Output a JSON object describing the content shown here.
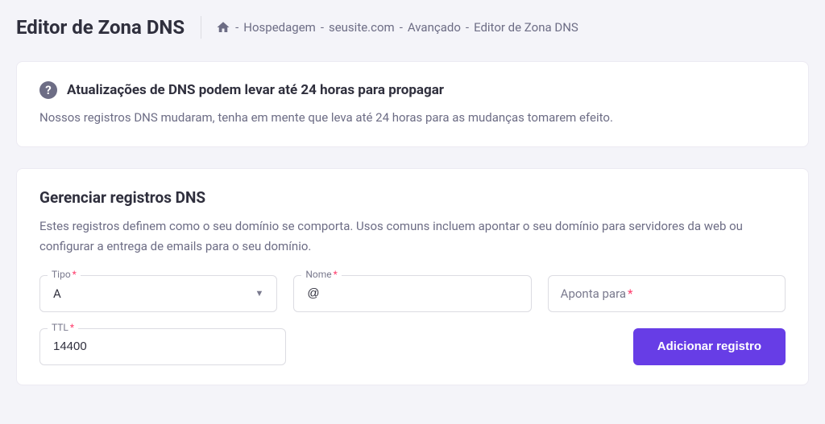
{
  "header": {
    "title": "Editor de Zona DNS"
  },
  "breadcrumb": {
    "items": [
      "Hospedagem",
      "seusite.com",
      "Avançado",
      "Editor de Zona DNS"
    ]
  },
  "alert": {
    "title": "Atualizações de DNS podem levar até 24 horas para propagar",
    "body": "Nossos registros DNS mudaram, tenha em mente que leva até 24 horas para as mudanças tomarem efeito."
  },
  "manage": {
    "title": "Gerenciar registros DNS",
    "description": "Estes registros definem como o seu domínio se comporta. Usos comuns incluem apontar o seu domínio para servidores da web ou configurar a entrega de emails para o seu domínio.",
    "fields": {
      "type": {
        "label": "Tipo",
        "value": "A"
      },
      "name": {
        "label": "Nome",
        "value": "@"
      },
      "points_to": {
        "label": "Aponta para",
        "value": ""
      },
      "ttl": {
        "label": "TTL",
        "value": "14400"
      }
    },
    "submit_label": "Adicionar registro"
  },
  "glyphs": {
    "required": "*",
    "sep": "-"
  }
}
